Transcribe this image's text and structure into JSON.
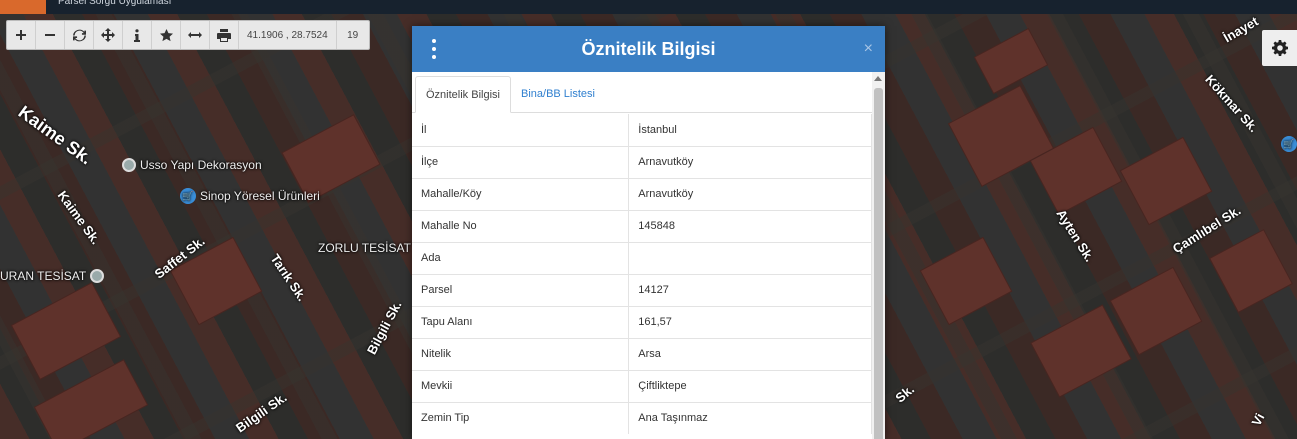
{
  "app": {
    "title": "Parsel Sorgu Uygulaması"
  },
  "toolbar": {
    "coords": "41.1906 , 28.7524",
    "zoom": "19"
  },
  "map": {
    "streets": [
      "Kaime Sk.",
      "Kaime Sk.",
      "Saffet Sk.",
      "Tarık Sk.",
      "Bilgili Sk.",
      "Bilgili Sk.",
      "Kökmar Sk.",
      "Ayten Sk.",
      "Çamlıbel Sk.",
      "İnayet",
      "Sk.",
      "Vi"
    ],
    "pois": [
      "Usso Yapı Dekorasyon",
      "Sinop Yöresel Ürünleri",
      "ZORLU TESİSAT",
      "URAN TESİSAT"
    ]
  },
  "dialog": {
    "title": "Öznitelik Bilgisi",
    "close": "×",
    "tabs": [
      {
        "label": "Öznitelik Bilgisi",
        "active": true
      },
      {
        "label": "Bina/BB Listesi",
        "active": false
      }
    ],
    "rows": [
      {
        "key": "İl",
        "value": "İstanbul"
      },
      {
        "key": "İlçe",
        "value": "Arnavutköy"
      },
      {
        "key": "Mahalle/Köy",
        "value": "Arnavutköy"
      },
      {
        "key": "Mahalle No",
        "value": "145848"
      },
      {
        "key": "Ada",
        "value": ""
      },
      {
        "key": "Parsel",
        "value": "14127"
      },
      {
        "key": "Tapu Alanı",
        "value": "161,57"
      },
      {
        "key": "Nitelik",
        "value": "Arsa"
      },
      {
        "key": "Mevkii",
        "value": "Çiftliktepe"
      },
      {
        "key": "Zemin Tip",
        "value": "Ana Taşınmaz"
      }
    ]
  },
  "colors": {
    "header_blue": "#3a7fc4",
    "tab_link": "#2f7fcf",
    "logo_orange": "#d9692c",
    "topbar": "#17222e"
  }
}
